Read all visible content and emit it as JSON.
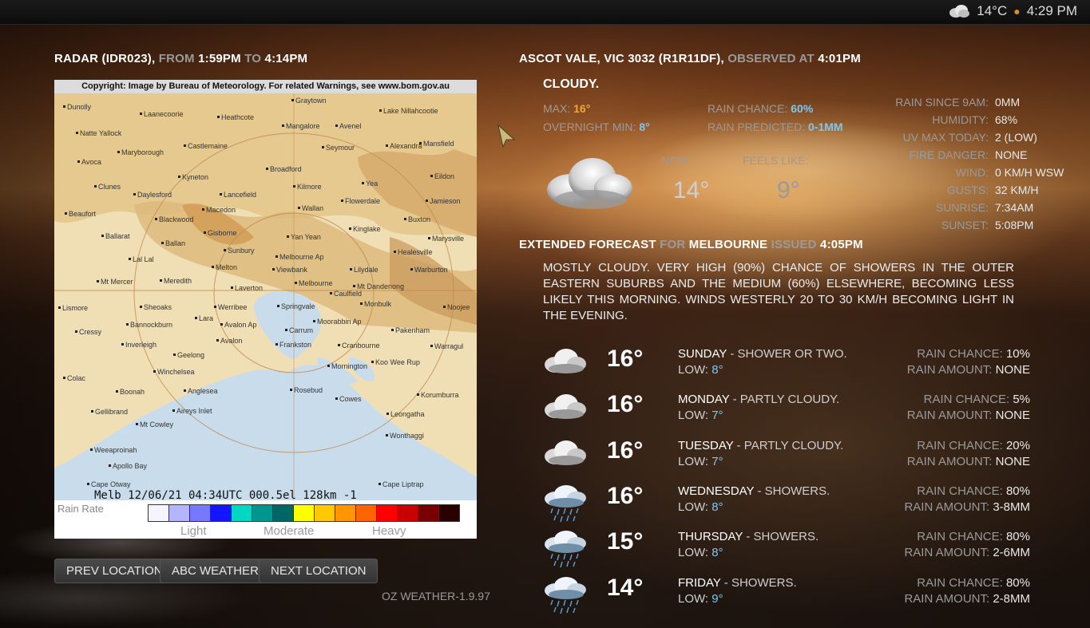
{
  "topbar": {
    "temp": "14°C",
    "time": "4:29 PM",
    "icon": "cloud-icon"
  },
  "radar": {
    "header": {
      "prefix": "RADAR (IDR023),",
      "from_label": "FROM",
      "from": "1:59PM",
      "to_label": "TO",
      "to": "4:14PM"
    },
    "copyright": "Copyright: Image by Bureau of Meteorology. For related Warnings, see www.bom.gov.au",
    "status_line": "Melb    12/06/21 04:34UTC 000.5el 128km -1",
    "legend": {
      "title": "Rain Rate",
      "light": "Light",
      "moderate": "Moderate",
      "heavy": "Heavy",
      "colors": [
        "#f5f5ff",
        "#b4b4ff",
        "#7878ff",
        "#1414ff",
        "#00d8c3",
        "#009690",
        "#006666",
        "#ffff00",
        "#ffc800",
        "#ff9600",
        "#ff6400",
        "#ff0000",
        "#c80000",
        "#780000",
        "#280000"
      ]
    },
    "places": [
      "Dunolly",
      "Laanecoorie",
      "Heathcote",
      "Graytown",
      "Lake Nillahcootie",
      "Natte Yallock",
      "Mangalore",
      "Avenel",
      "Maryborough",
      "Castlemaine",
      "Seymour",
      "Mansfield",
      "Avoca",
      "Broadford",
      "Alexandra",
      "Kyneton",
      "Yea",
      "Eildon",
      "Clunes",
      "Daylesford",
      "Lancefield",
      "Kilmore",
      "Flowerdale",
      "Jamieson",
      "Beaufort",
      "Wallan",
      "Blackwood",
      "Macedon",
      "Kinglake",
      "Buxton",
      "Gisborne",
      "Ballarat",
      "Yan Yean",
      "Marysville",
      "Ballan",
      "Sunbury",
      "Healesville",
      "Lal Lal",
      "Melbourne Ap",
      "Melton",
      "Viewbank",
      "Lilydale",
      "Warburton",
      "Mt Mercer",
      "Meredith",
      "Melbourne",
      "Mt Dandenong",
      "Laverton",
      "Caulfield",
      "Lismore",
      "Sheoaks",
      "Werribee",
      "Springvale",
      "Monbulk",
      "Noojee",
      "Lara",
      "Avalon Ap",
      "Moorabbin Ap",
      "Bannockburn",
      "Cressy",
      "Carrum",
      "Pakenham",
      "Avalon",
      "Inverleigh",
      "Frankston",
      "Cranbourne",
      "Warragul",
      "Geelong",
      "Koo Wee Rup",
      "Winchelsea",
      "Mornington",
      "Colac",
      "Anglesea",
      "Rosebud",
      "Cowes",
      "Korumburra",
      "Boonah",
      "Aireys Inlet",
      "Gellibrand",
      "Leongatha",
      "Mt Cowley",
      "Wonthaggi",
      "Weeaproinah",
      "Apollo Bay",
      "Cape Otway",
      "Cape Liptrap"
    ]
  },
  "buttons": {
    "prev": "PREV LOCATION",
    "abc": "ABC WEATHER",
    "next": "NEXT LOCATION"
  },
  "version": "OZ WEATHER-1.9.97",
  "current": {
    "header": {
      "location": "ASCOT VALE, VIC 3032 (R1R11DF),",
      "observed_label": "OBSERVED AT",
      "observed": "4:01PM"
    },
    "condition": "CLOUDY.",
    "max_label": "MAX:",
    "max": "16°",
    "min_label": "OVERNIGHT MIN:",
    "min": "8°",
    "rain_chance_label": "RAIN CHANCE:",
    "rain_chance": "60%",
    "rain_predicted_label": "RAIN PREDICTED:",
    "rain_predicted": "0-1MM",
    "now_label": "NOW:",
    "now": "14°",
    "feels_label": "FEELS LIKE:",
    "feels": "9°",
    "details": [
      {
        "label": "RAIN SINCE 9AM:",
        "value": "0MM"
      },
      {
        "label": "HUMIDITY:",
        "value": "68%"
      },
      {
        "label": "UV MAX TODAY:",
        "value": "2 (LOW)"
      },
      {
        "label": "FIRE DANGER:",
        "value": "NONE"
      },
      {
        "label": "WIND:",
        "value": "0 KM/H WSW"
      },
      {
        "label": "GUSTS:",
        "value": "32 KM/H"
      },
      {
        "label": "SUNRISE:",
        "value": "7:34AM"
      },
      {
        "label": "SUNSET:",
        "value": "5:08PM"
      }
    ]
  },
  "extended": {
    "header": {
      "title": "EXTENDED FORECAST",
      "for_label": "FOR",
      "city": "MELBOURNE",
      "issued_label": "ISSUED",
      "issued": "4:05PM"
    },
    "text": "MOSTLY CLOUDY. VERY HIGH (90%) CHANCE OF SHOWERS IN THE OUTER EASTERN SUBURBS AND THE MEDIUM (60%) ELSEWHERE, BECOMING LESS LIKELY THIS MORNING. WINDS WESTERLY 20 TO 30 KM/H BECOMING LIGHT IN THE EVENING."
  },
  "days": [
    {
      "temp": "16°",
      "day": "SUNDAY",
      "desc": "- SHOWER OR TWO.",
      "low_label": "LOW:",
      "low": "8°",
      "rc_label": "RAIN CHANCE:",
      "rc": "10%",
      "ra_label": "RAIN AMOUNT:",
      "ra": "NONE",
      "icon": "cloud-icon"
    },
    {
      "temp": "16°",
      "day": "MONDAY",
      "desc": "- PARTLY CLOUDY.",
      "low_label": "LOW:",
      "low": "7°",
      "rc_label": "RAIN CHANCE:",
      "rc": "5%",
      "ra_label": "RAIN AMOUNT:",
      "ra": "NONE",
      "icon": "cloud-icon"
    },
    {
      "temp": "16°",
      "day": "TUESDAY",
      "desc": "- PARTLY CLOUDY.",
      "low_label": "LOW:",
      "low": "7°",
      "rc_label": "RAIN CHANCE:",
      "rc": "20%",
      "ra_label": "RAIN AMOUNT:",
      "ra": "NONE",
      "icon": "cloud-icon"
    },
    {
      "temp": "16°",
      "day": "WEDNESDAY",
      "desc": "- SHOWERS.",
      "low_label": "LOW:",
      "low": "8°",
      "rc_label": "RAIN CHANCE:",
      "rc": "80%",
      "ra_label": "RAIN AMOUNT:",
      "ra": "3-8MM",
      "icon": "rain-cloud-icon"
    },
    {
      "temp": "15°",
      "day": "THURSDAY",
      "desc": "- SHOWERS.",
      "low_label": "LOW:",
      "low": "8°",
      "rc_label": "RAIN CHANCE:",
      "rc": "80%",
      "ra_label": "RAIN AMOUNT:",
      "ra": "2-6MM",
      "icon": "rain-cloud-icon"
    },
    {
      "temp": "14°",
      "day": "FRIDAY",
      "desc": "- SHOWERS.",
      "low_label": "LOW:",
      "low": "9°",
      "rc_label": "RAIN CHANCE:",
      "rc": "80%",
      "ra_label": "RAIN AMOUNT:",
      "ra": "2-8MM",
      "icon": "rain-cloud-icon"
    }
  ]
}
